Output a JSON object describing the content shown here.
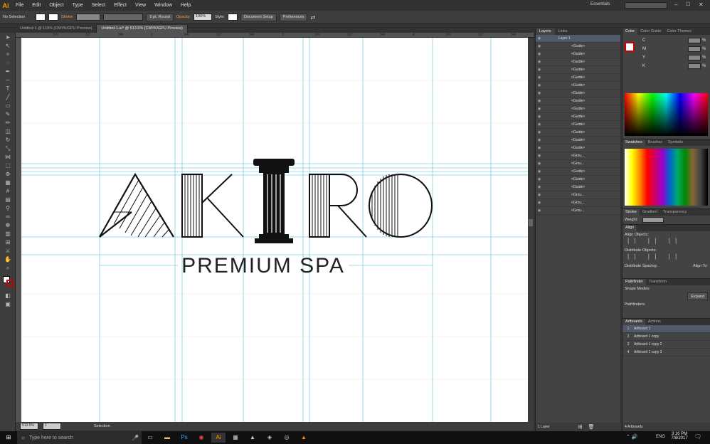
{
  "menubar": {
    "logo": "Ai",
    "items": [
      "File",
      "Edit",
      "Object",
      "Type",
      "Select",
      "Effect",
      "View",
      "Window",
      "Help"
    ],
    "workspace": "Essentials"
  },
  "control": {
    "selection": "No Selection",
    "stroke_label": "Stroke:",
    "brush": "5 pt. Round",
    "opacity_label": "Opacity:",
    "opacity": "100%",
    "style_label": "Style:",
    "doc_setup": "Document Setup",
    "preferences": "Preferences"
  },
  "tabs": [
    {
      "label": "Untitled-1 @ 119% (CMYK/GPU Preview)"
    },
    {
      "label": "Untitled-1.ai* @ 513.5% (CMYK/GPU Preview)"
    }
  ],
  "ruler": {
    "ticks": [
      "1/4",
      "1/2",
      "3/4",
      "2",
      "1/4",
      "1/2",
      "3/4",
      "3",
      "1/4",
      "1/2",
      "3/4",
      "4",
      "1/4",
      "1/2",
      "3/4"
    ]
  },
  "artwork": {
    "logo": "AKIRO",
    "tagline": "PREMIUM SPA"
  },
  "status": {
    "zoom": "513.5%",
    "page": "1",
    "tool": "Selection"
  },
  "layers": {
    "tabs": [
      "Layers",
      "Links"
    ],
    "layer_name": "Layer 1",
    "rows": [
      "<Guide>",
      "<Guide>",
      "<Guide>",
      "<Guide>",
      "<Guide>",
      "<Guide>",
      "<Guide>",
      "<Guide>",
      "<Guide>",
      "<Guide>",
      "<Guide>",
      "<Guide>",
      "<Guide>",
      "<Guide>",
      "<Grou...",
      "<Grou...",
      "<Guide>",
      "<Guide>",
      "<Guide>",
      "<Grou...",
      "<Grou...",
      "<Grou..."
    ],
    "footer": "1 Layer"
  },
  "color": {
    "tabs": [
      "Color",
      "Color Guide",
      "Color Themes"
    ],
    "channels": [
      "C",
      "M",
      "Y",
      "K"
    ],
    "unit": "%"
  },
  "swatches": {
    "tabs": [
      "Swatches",
      "Brushes",
      "Symbols"
    ]
  },
  "stroke": {
    "tabs": [
      "Stroke",
      "Gradient",
      "Transparency"
    ],
    "weight_label": "Weight:"
  },
  "align": {
    "title": "Align",
    "objects": "Align Objects:",
    "distribute": "Distribute Objects:",
    "spacing": "Distribute Spacing:",
    "align_to": "Align To:"
  },
  "pathfinder": {
    "tabs": [
      "Pathfinder",
      "Transform"
    ],
    "shape_modes": "Shape Modes:",
    "pathfinders": "Pathfinders:",
    "expand": "Expand"
  },
  "artboards": {
    "tabs": [
      "Artboards",
      "Actions"
    ],
    "rows": [
      {
        "n": "1",
        "name": "Artboard 1"
      },
      {
        "n": "2",
        "name": "Artboard 1 copy"
      },
      {
        "n": "3",
        "name": "Artboard 1 copy 2"
      },
      {
        "n": "4",
        "name": "Artboard 1 copy 3"
      }
    ],
    "footer": "4 Artboards"
  },
  "taskbar": {
    "search": "Type here to search",
    "time": "3:16 PM",
    "date": "7/8/2017",
    "lang": "ENG"
  },
  "colors": {
    "guide": "#7ecfe0",
    "accent": "#ff9a00"
  }
}
